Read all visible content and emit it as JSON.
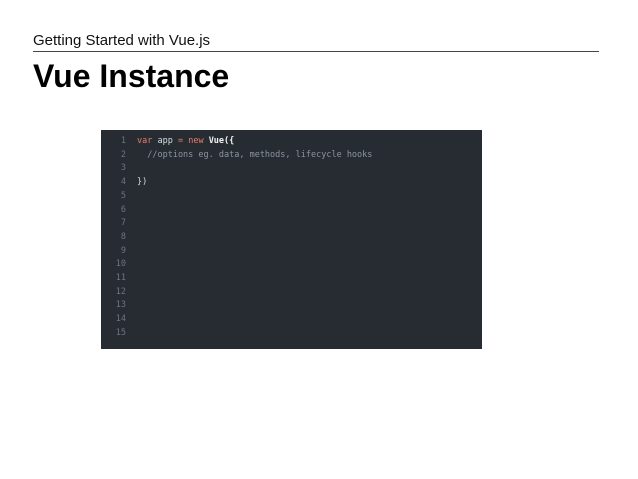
{
  "slide": {
    "header": "Getting Started with Vue.js",
    "title": "Vue Instance"
  },
  "colors": {
    "editor_background": "#272c33",
    "keyword": "#e97c6f",
    "line_number": "#6b747f",
    "comment": "#8a95a3"
  },
  "editor": {
    "lines": [
      {
        "number": "1",
        "tokens": [
          {
            "text": "var",
            "kind": "kw"
          },
          {
            "text": " app ",
            "kind": "plain"
          },
          {
            "text": "=",
            "kind": "op"
          },
          {
            "text": " ",
            "kind": "plain"
          },
          {
            "text": "new",
            "kind": "kw"
          },
          {
            "text": " ",
            "kind": "plain"
          },
          {
            "text": "Vue({",
            "kind": "cls"
          }
        ]
      },
      {
        "number": "2",
        "tokens": [
          {
            "text": "  //options eg. data, methods, lifecycle hooks",
            "kind": "comment"
          }
        ]
      },
      {
        "number": "3",
        "tokens": []
      },
      {
        "number": "4",
        "tokens": [
          {
            "text": "})",
            "kind": "plain"
          }
        ]
      },
      {
        "number": "5",
        "tokens": []
      },
      {
        "number": "6",
        "tokens": []
      },
      {
        "number": "7",
        "tokens": []
      },
      {
        "number": "8",
        "tokens": []
      },
      {
        "number": "9",
        "tokens": []
      },
      {
        "number": "10",
        "tokens": []
      },
      {
        "number": "11",
        "tokens": []
      },
      {
        "number": "12",
        "tokens": []
      },
      {
        "number": "13",
        "tokens": []
      },
      {
        "number": "14",
        "tokens": []
      },
      {
        "number": "15",
        "tokens": []
      }
    ]
  }
}
